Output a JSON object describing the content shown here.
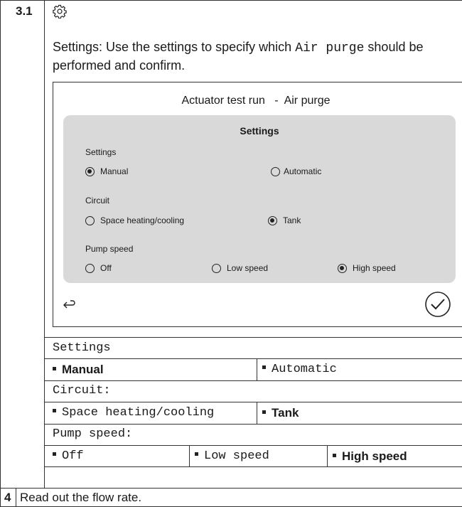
{
  "step31": {
    "number": "3.1",
    "icon": "gear-icon",
    "instruction_prefix": "Settings: Use the settings to specify which",
    "instruction_code": "Air purge",
    "instruction_suffix": "should be performed and confirm."
  },
  "screen": {
    "title_left": "Actuator test run",
    "title_sep": "-",
    "title_right": "Air purge",
    "panel_title": "Settings",
    "groups": [
      {
        "label": "Settings",
        "options": [
          {
            "label": "Manual",
            "selected": true
          },
          {
            "label": "Automatic",
            "selected": false
          }
        ]
      },
      {
        "label": "Circuit",
        "options": [
          {
            "label": "Space heating/cooling",
            "selected": false
          },
          {
            "label": "Tank",
            "selected": true
          }
        ]
      },
      {
        "label": "Pump speed",
        "options": [
          {
            "label": "Off",
            "selected": false
          },
          {
            "label": "Low speed",
            "selected": false
          },
          {
            "label": "High speed",
            "selected": true
          }
        ]
      }
    ],
    "back_icon": "back-arrow-icon",
    "confirm_icon": "checkmark-circle-icon"
  },
  "table": {
    "settings_header": "Settings",
    "settings_opt1": "Manual",
    "settings_opt2": "Automatic",
    "circuit_header": "Circuit:",
    "circuit_opt1": "Space heating/cooling",
    "circuit_opt2": "Tank",
    "pump_header": "Pump speed:",
    "pump_opt1": "Off",
    "pump_opt2": "Low speed",
    "pump_opt3": "High speed"
  },
  "step4": {
    "number": "4",
    "text": "Read out the flow rate."
  }
}
